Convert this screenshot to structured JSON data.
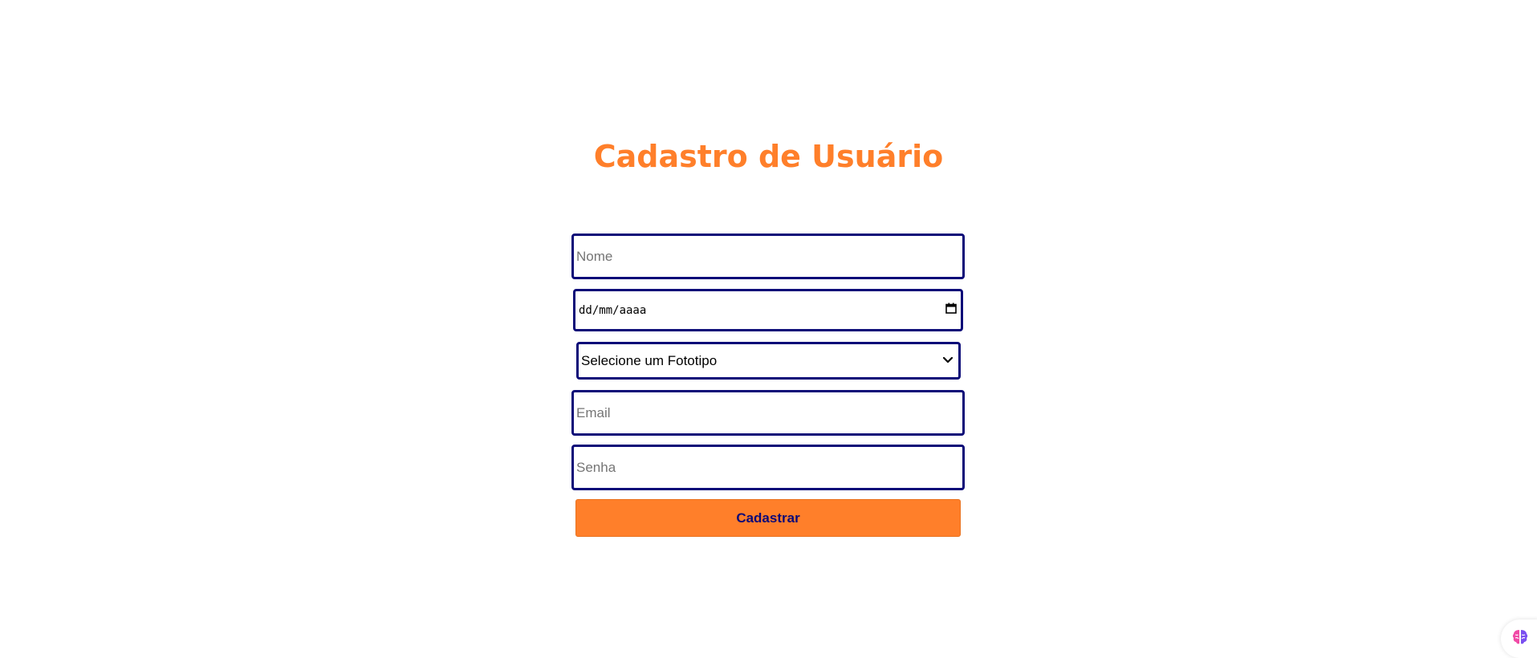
{
  "form": {
    "title": "Cadastro de Usuário",
    "name_placeholder": "Nome",
    "date_placeholder": "dd/mm/aaaa",
    "fototipo_selected": "Selecione um Fototipo",
    "email_placeholder": "Email",
    "password_placeholder": "Senha",
    "submit_label": "Cadastrar"
  },
  "colors": {
    "accent": "#ff7f2a",
    "border": "#0b0a78",
    "button_text": "#0b0a78"
  },
  "icons": {
    "date": "calendar-icon",
    "select": "chevron-down-icon",
    "assistant": "brain-icon"
  }
}
